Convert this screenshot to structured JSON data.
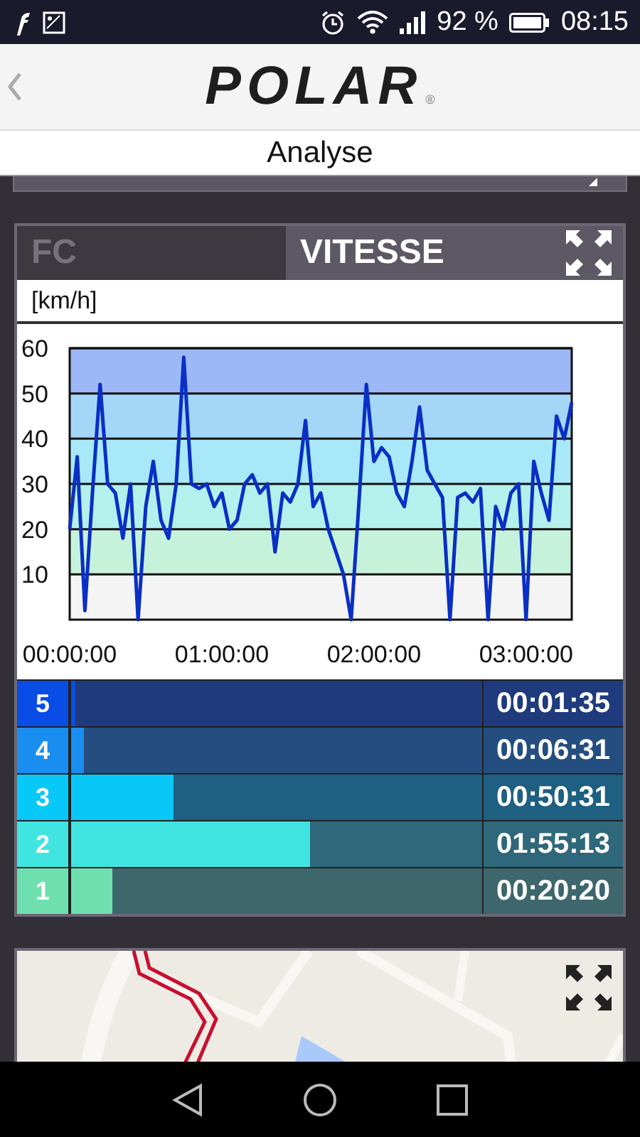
{
  "status_bar": {
    "battery": "92 %",
    "time": "08:15"
  },
  "header": {
    "logo": "POLAR",
    "logo_mark": "®"
  },
  "title": "Analyse",
  "tabs": [
    {
      "label": "FC",
      "selected": false
    },
    {
      "label": "VITESSE",
      "selected": true
    }
  ],
  "unit": "[km/h]",
  "chart_data": {
    "type": "line",
    "x": [
      0,
      3,
      6,
      9,
      12,
      15,
      18,
      21,
      24,
      27,
      30,
      33,
      36,
      39,
      42,
      45,
      48,
      51,
      54,
      57,
      60,
      63,
      66,
      69,
      72,
      75,
      78,
      81,
      84,
      87,
      90,
      93,
      96,
      99,
      102,
      105,
      108,
      111,
      114,
      117,
      120,
      123,
      126,
      129,
      132,
      135,
      138,
      141,
      144,
      147,
      150,
      153,
      156,
      159,
      162,
      165,
      168,
      171,
      174,
      177,
      180,
      183,
      186,
      189,
      192,
      195,
      198
    ],
    "grid": true,
    "series": [
      {
        "color": "#0a2fc4",
        "values": [
          20,
          36,
          2,
          28,
          52,
          30,
          28,
          18,
          30,
          0,
          25,
          35,
          22,
          18,
          30,
          58,
          30,
          29,
          30,
          25,
          28,
          20,
          22,
          30,
          32,
          28,
          30,
          15,
          28,
          26,
          30,
          44,
          25,
          28,
          20,
          15,
          10,
          0,
          25,
          52,
          35,
          38,
          36,
          28,
          25,
          35,
          47,
          33,
          30,
          27,
          0,
          27,
          28,
          26,
          29,
          0,
          25,
          20,
          28,
          30,
          0,
          35,
          28,
          22,
          45,
          40,
          48
        ]
      }
    ],
    "xlim": [
      0,
      198
    ],
    "ylim": [
      0,
      60
    ],
    "xticks": [
      {
        "value": 0,
        "label": "00:00:00"
      },
      {
        "value": 60,
        "label": "01:00:00"
      },
      {
        "value": 120,
        "label": "02:00:00"
      },
      {
        "value": 180,
        "label": "03:00:00"
      }
    ],
    "yticks": [
      10,
      20,
      30,
      40,
      50,
      60
    ]
  },
  "zones": [
    {
      "number": "5",
      "level": 0.01,
      "time": "00:01:35",
      "color": "#0a4de6"
    },
    {
      "number": "4",
      "level": 0.03,
      "time": "00:06:31",
      "color": "#1a8ef0"
    },
    {
      "number": "3",
      "level": 0.25,
      "time": "00:50:31",
      "color": "#08c8f8"
    },
    {
      "number": "2",
      "level": 0.58,
      "time": "01:55:13",
      "color": "#40e4e0"
    },
    {
      "number": "1",
      "level": 0.1,
      "time": "00:20:20",
      "color": "#6ee0b0"
    }
  ]
}
